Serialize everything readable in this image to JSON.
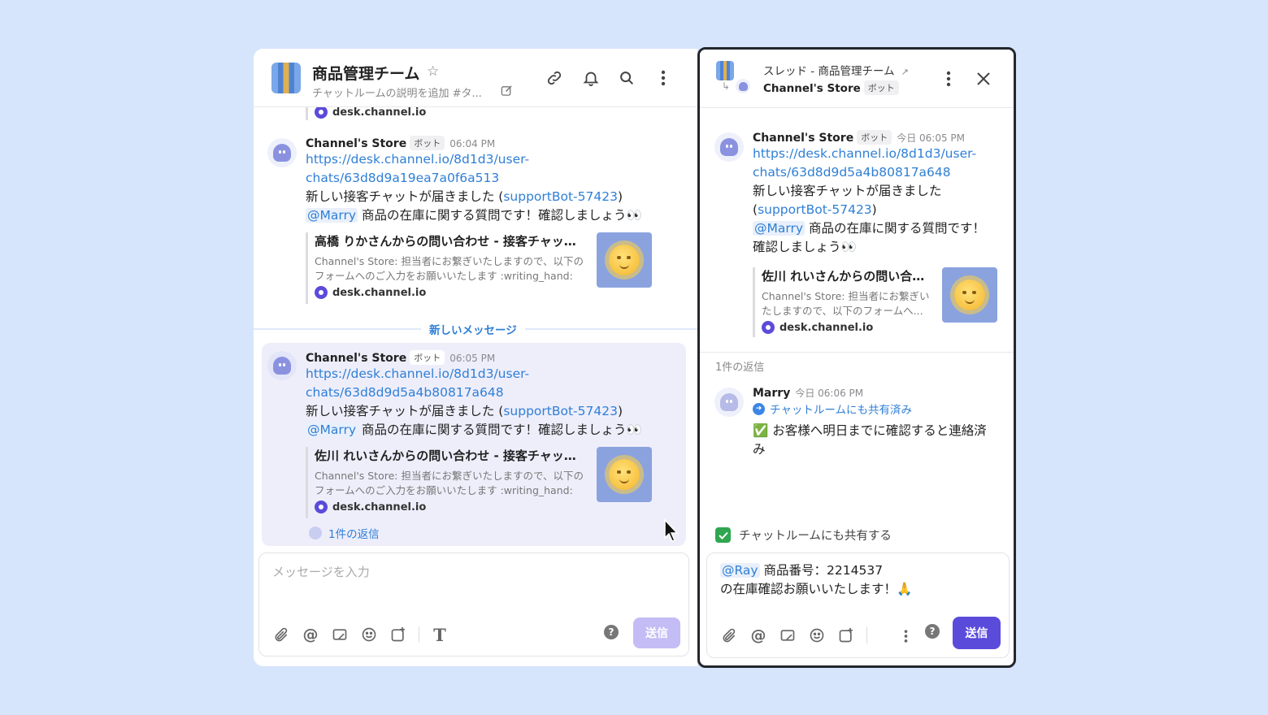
{
  "left": {
    "title": "商品管理チーム",
    "description": "チャットルームの説明を追加 #タ...",
    "top_preview_domain": "desk.channel.io",
    "new_messages_label": "新しいメッセージ",
    "messages": [
      {
        "sender": "Channel's Store",
        "badge": "ボット",
        "time": "06:04 PM",
        "link_line1": "https://desk.channel.io/8d1d3/user-",
        "link_line2": "chats/63d8d9a19ea7a0f6a513",
        "text_prefix": "新しい接客チャットが届きました (",
        "bot_link": "supportBot-57423",
        "text_suffix": ")",
        "mention": "@Marry",
        "text2": " 商品の在庫に関する質問です！確認しましょう👀",
        "preview_title": "高橋 りかさんからの問い合わせ - 接客チャット...",
        "preview_desc_line1": "Channel's Store: 担当者にお繋ぎいたしますので、以下の",
        "preview_desc_line2": "フォームへのご入力をお願いいたします :writing_hand:",
        "preview_domain": "desk.channel.io"
      },
      {
        "sender": "Channel's Store",
        "badge": "ボット",
        "time": "06:05 PM",
        "link_line1": "https://desk.channel.io/8d1d3/user-",
        "link_line2": "chats/63d8d9d5a4b80817a648",
        "text_prefix": "新しい接客チャットが届きました (",
        "bot_link": "supportBot-57423",
        "text_suffix": ")",
        "mention": "@Marry",
        "text2": " 商品の在庫に関する質問です！確認しましょう👀",
        "preview_title": "佐川 れいさんからの問い合わせ - 接客チャット...",
        "preview_desc_line1": "Channel's Store: 担当者にお繋ぎいたしますので、以下の",
        "preview_desc_line2": "フォームへのご入力をお願いいたします :writing_hand:",
        "preview_domain": "desk.channel.io",
        "replies": "1件の返信"
      }
    ],
    "composer_placeholder": "メッセージを入力",
    "send_label": "送信",
    "help": "?"
  },
  "right": {
    "thread_title": "スレッド - 商品管理チーム",
    "sub_sender": "Channel's Store",
    "sub_badge": "ボット",
    "root": {
      "sender": "Channel's Store",
      "badge": "ボット",
      "time": "今日 06:05 PM",
      "link_line1": "https://desk.channel.io/8d1d3/user-",
      "link_line2": "chats/63d8d9d5a4b80817a648",
      "text_line1": "新しい接客チャットが届きました",
      "text_paren_open": "(",
      "bot_link": "supportBot-57423",
      "text_paren_close": ")",
      "mention": "@Marry",
      "text2": " 商品の在庫に関する質問です！",
      "text3": "確認しましょう👀",
      "preview_title": "佐川 れいさんからの問い合わ...",
      "preview_desc_line1": "Channel's Store: 担当者にお繋ぎい",
      "preview_desc_line2": "たしますので、以下のフォームへ...",
      "preview_domain": "desk.channel.io"
    },
    "reply_count": "1件の返信",
    "reply": {
      "sender": "Marry",
      "time": "今日 06:06 PM",
      "shared": "チャットルームにも共有済み",
      "text_line1": "✅ お客様へ明日までに確認すると連絡済",
      "text_line2": "み"
    },
    "share_checkbox_label": "チャットルームにも共有する",
    "composer": {
      "mention": "@Ray",
      "line1": " 商品番号：2214537",
      "line2": "の在庫確認お願いいたします！🙏"
    },
    "send_label": "送信",
    "help": "?"
  },
  "colors": {
    "background": "#d6e5fb",
    "link": "#2f7fd6",
    "send_active": "#5b4bdb",
    "send_disabled": "#c4bcf5",
    "highlight": "#eeeefb"
  }
}
